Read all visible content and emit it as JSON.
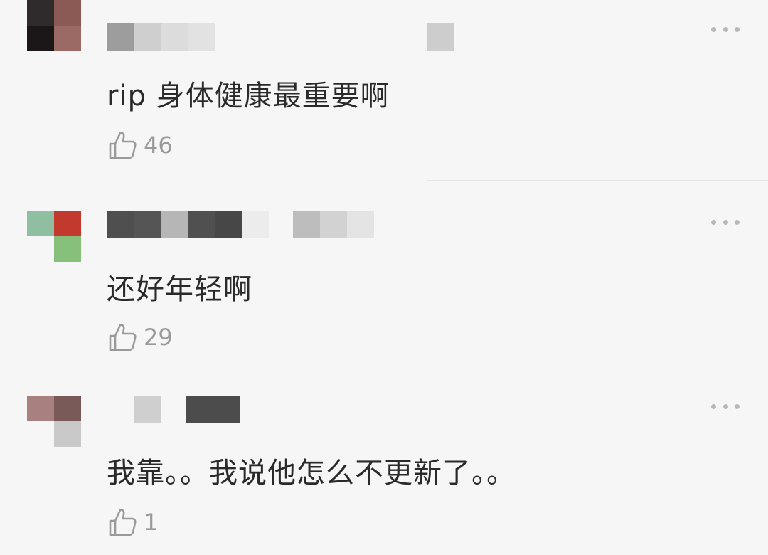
{
  "comments": [
    {
      "text": "rip 身体健康最重要啊",
      "likes": "46",
      "icons": {
        "like": "thumbs-up-icon",
        "more": "more-dots-icon"
      }
    },
    {
      "text": "还好年轻啊",
      "likes": "29",
      "icons": {
        "like": "thumbs-up-icon",
        "more": "more-dots-icon"
      }
    },
    {
      "text": "我靠。。我说他怎么不更新了。。",
      "likes": "1",
      "icons": {
        "like": "thumbs-up-icon",
        "more": "more-dots-icon"
      }
    }
  ],
  "colors": {
    "background": "#f7f6f6",
    "text": "#2a2a2a",
    "muted": "#9a9a9a",
    "avatar1": [
      "#2f2b2c",
      "#8b5a55",
      "#1b1618",
      "#9c6a64"
    ],
    "avatar2": [
      "#8fbfa0",
      "#c23a2e",
      "#f7f6f6",
      "#86c07a"
    ],
    "avatar3": [
      "#a8807f",
      "#7a5a58",
      "#f7f6f6",
      "#c9c9c9"
    ]
  }
}
